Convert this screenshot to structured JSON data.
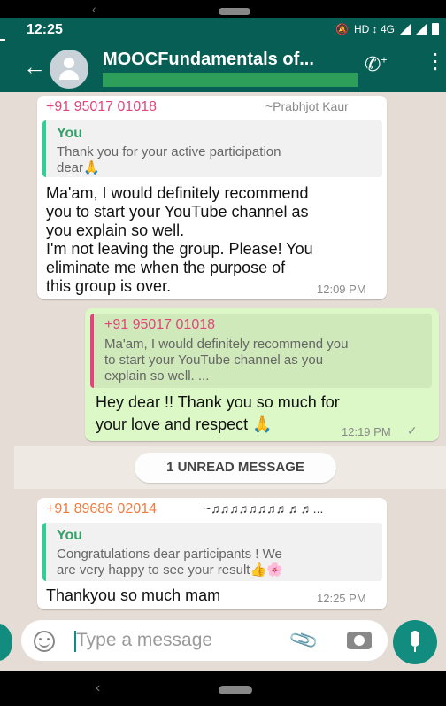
{
  "status_bar": {
    "time": "12:25",
    "network": "HD ↕ 4G"
  },
  "header": {
    "title": "MOOCFundamentals of..."
  },
  "messages": [
    {
      "sender_phone": "+91 95017 01018",
      "sender_alias": "~Prabhjot Kaur",
      "quote_sender": "You",
      "quote_text_line1": "Thank you for your active participation",
      "quote_text_line2": "dear🙏",
      "body_lines": [
        "Ma'am, I would definitely recommend",
        "you to start your YouTube channel as",
        "you explain so well.",
        "I'm not leaving the group. Please! You",
        "eliminate me when the purpose of",
        "this group is over."
      ],
      "time": "12:09 PM"
    },
    {
      "quote_sender": "+91 95017 01018",
      "quote_lines": [
        "Ma'am, I would definitely recommend you",
        "to start your YouTube channel as you",
        "explain so well. ..."
      ],
      "body_lines": [
        "Hey dear !! Thank you so much for",
        "your love and respect 🙏"
      ],
      "time": "12:19 PM",
      "tick": "✓"
    },
    {
      "sender_phone": "+91 89686 02014",
      "sender_alias": "~♫♫♫♫♫♫♫♬♬♬...",
      "quote_sender": "You",
      "quote_text_line1": "Congratulations dear participants ! We",
      "quote_text_line2": "are very happy to see your result👍🌸",
      "body": "Thankyou  so much mam",
      "time": "12:25 PM"
    }
  ],
  "unread_label": "1 UNREAD MESSAGE",
  "input": {
    "placeholder": "Type a message"
  },
  "icons": [
    "back-arrow-icon",
    "group-avatar-icon",
    "add-call-icon",
    "more-menu-icon",
    "emoji-icon",
    "attach-icon",
    "camera-icon",
    "mic-icon"
  ],
  "colors": {
    "header": "#075e54",
    "outgoing": "#dcf8c6",
    "incoming": "#ffffff",
    "accent": "#128c7e",
    "background": "#e5ddd5"
  }
}
